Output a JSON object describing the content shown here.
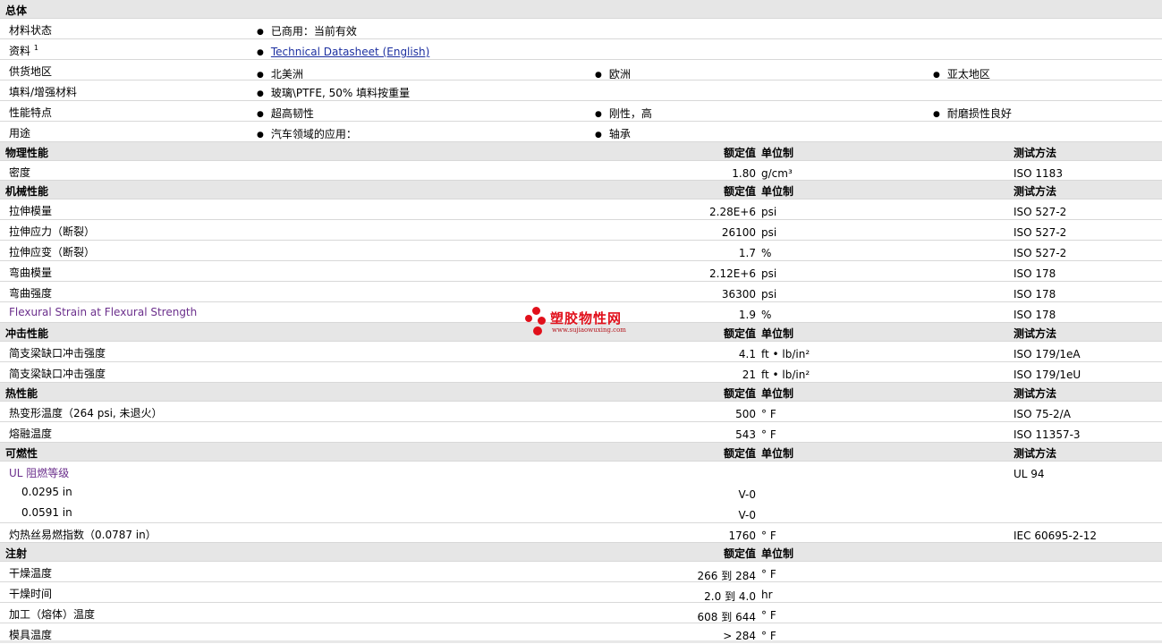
{
  "watermark": {
    "title": "塑胶物性网",
    "url": "www.sujiaowuxing.com"
  },
  "general": {
    "title": "总体",
    "status": {
      "label": "材料状态",
      "value": "已商用：当前有效"
    },
    "docs": {
      "label": "资料",
      "sup": "1",
      "link": "Technical Datasheet (English)"
    },
    "region": {
      "label": "供货地区",
      "v1": "北美洲",
      "v2": "欧洲",
      "v3": "亚太地区"
    },
    "filler": {
      "label": "填料/增强材料",
      "value": "玻璃\\PTFE, 50% 填料按重量"
    },
    "features": {
      "label": "性能特点",
      "v1": "超高韧性",
      "v2": "刚性，高",
      "v3": "耐磨损性良好"
    },
    "uses": {
      "label": "用途",
      "v1": "汽车领域的应用：",
      "v2": "轴承"
    }
  },
  "headers": {
    "rated": "额定值",
    "unit": "单位制",
    "test": "测试方法"
  },
  "physical": {
    "title": "物理性能",
    "rows": [
      {
        "label": "密度",
        "value": "1.80",
        "unit": "g/cm³",
        "test": "ISO 1183"
      }
    ]
  },
  "mechanical": {
    "title": "机械性能",
    "rows": [
      {
        "label": "拉伸模量",
        "value": "2.28E+6",
        "unit": "psi",
        "test": "ISO 527-2"
      },
      {
        "label": "拉伸应力（断裂）",
        "value": "26100",
        "unit": "psi",
        "test": "ISO 527-2"
      },
      {
        "label": "拉伸应变（断裂）",
        "value": "1.7",
        "unit": "%",
        "test": "ISO 527-2"
      },
      {
        "label": "弯曲模量",
        "value": "2.12E+6",
        "unit": "psi",
        "test": "ISO 178"
      },
      {
        "label": "弯曲强度",
        "value": "36300",
        "unit": "psi",
        "test": "ISO 178"
      },
      {
        "label": "Flexural Strain at Flexural Strength",
        "value": "1.9",
        "unit": "%",
        "test": "ISO 178"
      }
    ]
  },
  "impact": {
    "title": "冲击性能",
    "rows": [
      {
        "label": "简支梁缺口冲击强度",
        "value": "4.1",
        "unit": "ft • lb/in²",
        "test": "ISO 179/1eA"
      },
      {
        "label": "简支梁缺口冲击强度",
        "value": "21",
        "unit": "ft • lb/in²",
        "test": "ISO 179/1eU"
      }
    ]
  },
  "thermal": {
    "title": "热性能",
    "rows": [
      {
        "label": "热变形温度（264 psi, 未退火）",
        "value": "500",
        "unit": "° F",
        "test": "ISO 75-2/A"
      },
      {
        "label": "熔融温度",
        "value": "543",
        "unit": "° F",
        "test": "ISO 11357-3"
      }
    ]
  },
  "flammability": {
    "title": "可燃性",
    "ul": {
      "label": "UL 阻燃等级",
      "test": "UL 94"
    },
    "sub1": {
      "label": "0.0295 in",
      "value": "V-0"
    },
    "sub2": {
      "label": "0.0591 in",
      "value": "V-0"
    },
    "gwfi": {
      "label": "灼热丝易燃指数（0.0787 in）",
      "value": "1760",
      "unit": "° F",
      "test": "IEC 60695-2-12"
    }
  },
  "injection": {
    "title": "注射",
    "rows": [
      {
        "label": "干燥温度",
        "from": "266",
        "to_word": "到",
        "to": "284",
        "unit": "° F"
      },
      {
        "label": "干燥时间",
        "from": "2.0",
        "to_word": "到",
        "to": "4.0",
        "unit": "hr"
      },
      {
        "label": "加工（熔体）温度",
        "from": "608",
        "to_word": "到",
        "to": "644",
        "unit": "° F"
      }
    ],
    "mold": {
      "label": "模具温度",
      "value": "> 284",
      "unit": "° F"
    }
  }
}
